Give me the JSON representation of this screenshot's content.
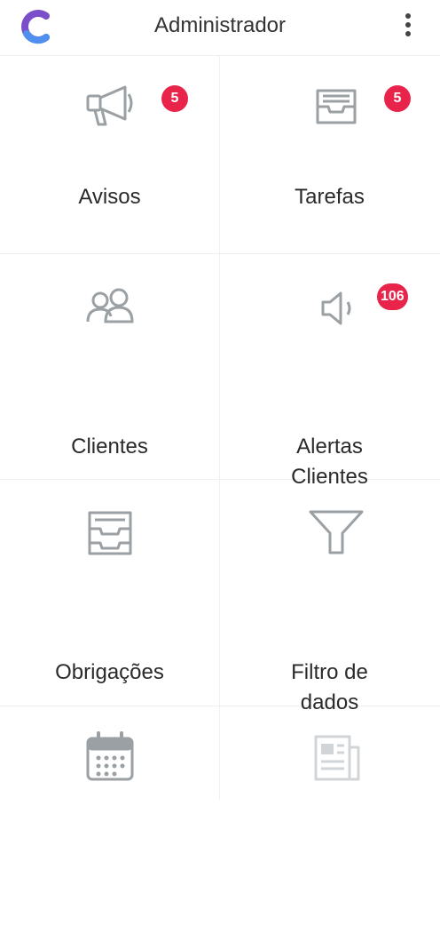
{
  "header": {
    "title": "Administrador",
    "logo_icon": "app-logo-c",
    "menu_icon": "more-vert-icon"
  },
  "colors": {
    "badge": "#e8244a",
    "icon": "#9aa0a3",
    "logo_purple": "#7b4fc9",
    "logo_blue": "#4f8ff0"
  },
  "tiles": [
    {
      "label": "Avisos",
      "icon": "megaphone-icon",
      "badge": "5"
    },
    {
      "label": "Tarefas",
      "icon": "inbox-tray-icon",
      "badge": "5"
    },
    {
      "label": "Clientes",
      "icon": "users-icon",
      "badge": ""
    },
    {
      "label": "Alertas\nClientes",
      "icon": "speaker-icon",
      "badge": "106"
    },
    {
      "label": "Obrigações",
      "icon": "inbox-stack-icon",
      "badge": ""
    },
    {
      "label": "Filtro de\ndados",
      "icon": "funnel-icon",
      "badge": ""
    },
    {
      "label": "",
      "icon": "calendar-icon",
      "badge": ""
    },
    {
      "label": "",
      "icon": "newspaper-icon",
      "badge": ""
    }
  ]
}
